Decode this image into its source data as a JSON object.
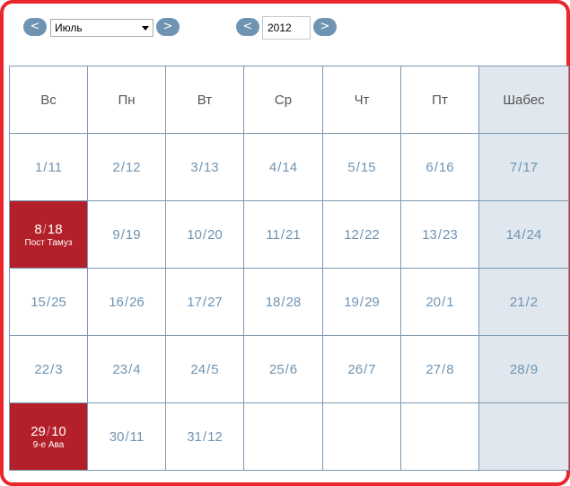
{
  "navigation": {
    "prev_month_label": "<",
    "next_month_label": ">",
    "month_value": "Июль",
    "prev_year_label": "<",
    "next_year_label": ">",
    "year_value": "2012"
  },
  "weekdays": [
    "Вс",
    "Пн",
    "Вт",
    "Ср",
    "Чт",
    "Пт",
    "Шабес"
  ],
  "weeks": [
    [
      {
        "g": "1",
        "h": "11"
      },
      {
        "g": "2",
        "h": "12"
      },
      {
        "g": "3",
        "h": "13"
      },
      {
        "g": "4",
        "h": "14"
      },
      {
        "g": "5",
        "h": "15"
      },
      {
        "g": "6",
        "h": "16"
      },
      {
        "g": "7",
        "h": "17"
      }
    ],
    [
      {
        "g": "8",
        "h": "18",
        "holiday": "Пост Тамуз"
      },
      {
        "g": "9",
        "h": "19"
      },
      {
        "g": "10",
        "h": "20"
      },
      {
        "g": "11",
        "h": "21"
      },
      {
        "g": "12",
        "h": "22"
      },
      {
        "g": "13",
        "h": "23"
      },
      {
        "g": "14",
        "h": "24"
      }
    ],
    [
      {
        "g": "15",
        "h": "25"
      },
      {
        "g": "16",
        "h": "26"
      },
      {
        "g": "17",
        "h": "27"
      },
      {
        "g": "18",
        "h": "28"
      },
      {
        "g": "19",
        "h": "29"
      },
      {
        "g": "20",
        "h": "1"
      },
      {
        "g": "21",
        "h": "2"
      }
    ],
    [
      {
        "g": "22",
        "h": "3"
      },
      {
        "g": "23",
        "h": "4"
      },
      {
        "g": "24",
        "h": "5"
      },
      {
        "g": "25",
        "h": "6"
      },
      {
        "g": "26",
        "h": "7"
      },
      {
        "g": "27",
        "h": "8"
      },
      {
        "g": "28",
        "h": "9"
      }
    ],
    [
      {
        "g": "29",
        "h": "10",
        "holiday": "9-е Ава"
      },
      {
        "g": "30",
        "h": "11"
      },
      {
        "g": "31",
        "h": "12"
      },
      null,
      null,
      null,
      null
    ]
  ],
  "date_separator": "/",
  "colors": {
    "frame_border": "#e8262c",
    "accent_blue": "#6f94b3",
    "holiday_bg": "#b3202a",
    "shabbat_bg": "#e0e7ee"
  }
}
